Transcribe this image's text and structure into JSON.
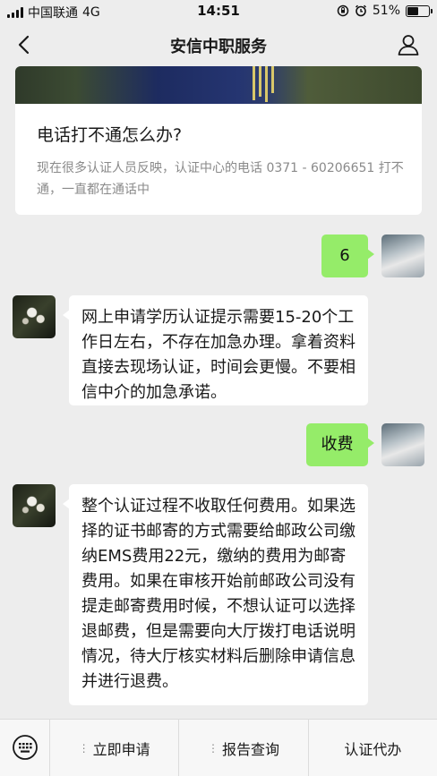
{
  "status_bar": {
    "carrier": "中国联通",
    "network": "4G",
    "time": "14:51",
    "battery_percent": "51%",
    "battery_level": 0.51
  },
  "nav": {
    "title": "安信中职服务"
  },
  "article": {
    "title": "电话打不通怎么办?",
    "summary": "现在很多认证人员反映，认证中心的电话 0371 - 60206651 打不通，一直都在通话中"
  },
  "messages": [
    {
      "side": "right",
      "text": "6"
    },
    {
      "side": "left",
      "text": "网上申请学历认证提示需要15-20个工作日左右，不存在加急办理。拿着资料直接去现场认证，时间会更慢。不要相信中介的加急承诺。"
    },
    {
      "side": "right",
      "text": "收费"
    },
    {
      "side": "left",
      "text": "整个认证过程不收取任何费用。如果选择的证书邮寄的方式需要给邮政公司缴纳EMS费用22元，缴纳的费用为邮寄费用。如果在审核开始前邮政公司没有提走邮寄费用时候，不想认证可以选择退邮费，但是需要向大厅拨打电话说明情况，待大厅核实材料后删除申请信息并进行退费。"
    }
  ],
  "menu": {
    "items": [
      {
        "label": "立即申请",
        "has_submenu": true
      },
      {
        "label": "报告查询",
        "has_submenu": true
      },
      {
        "label": "认证代办",
        "has_submenu": false
      }
    ]
  },
  "colors": {
    "background": "#ededed",
    "bubble_right": "#95ec69",
    "bubble_left": "#ffffff"
  }
}
